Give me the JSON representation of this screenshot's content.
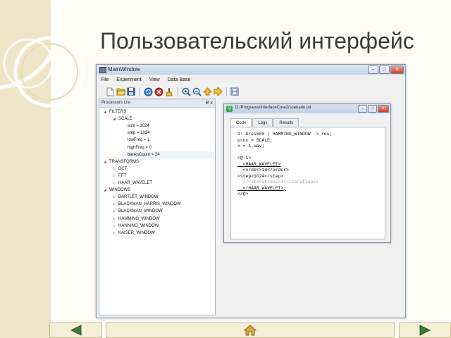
{
  "slide": {
    "title": "Пользовательский интерфейс"
  },
  "window": {
    "title": "MainWindow",
    "buttons": {
      "minimize": "–",
      "maximize": "□",
      "close": "x"
    }
  },
  "menu": [
    {
      "label": "File"
    },
    {
      "label": "Experiment"
    },
    {
      "label": "View"
    },
    {
      "label": "Data Base"
    }
  ],
  "toolbar": {
    "icons": [
      "new-file-icon",
      "open-folder-icon",
      "save-icon",
      "refresh-icon",
      "stop-icon",
      "brush-icon",
      "zoom-in-icon",
      "zoom-out-icon",
      "arrow-up-icon",
      "arrow-forward-icon",
      "export-icon"
    ]
  },
  "panel": {
    "title": "Processors List",
    "controls": "₽ x"
  },
  "tree": [
    {
      "label": "FILTERS",
      "level": 0,
      "expanded": true
    },
    {
      "label": "SCALE",
      "level": 1,
      "expanded": true
    },
    {
      "label": "size = 1024",
      "level": 2
    },
    {
      "label": "step = 1024",
      "level": 2
    },
    {
      "label": "lowFreq = 1",
      "level": 2
    },
    {
      "label": "highFreq = 0",
      "level": 2
    },
    {
      "label": "banksCount = 24",
      "level": 2,
      "selected": true
    },
    {
      "label": "TRANSFORMS",
      "level": 0,
      "expanded": true
    },
    {
      "label": "DCT",
      "level": 1,
      "expanded": false
    },
    {
      "label": "FFT",
      "level": 1,
      "expanded": false
    },
    {
      "label": "HAAR_WAVELET",
      "level": 1,
      "expanded": false
    },
    {
      "label": "WINDOWS",
      "level": 0,
      "expanded": true
    },
    {
      "label": "BARTLET_WINDOW",
      "level": 1,
      "expanded": false
    },
    {
      "label": "BLACKMAN_HARRIS_WINDOW",
      "level": 1,
      "expanded": false
    },
    {
      "label": "BLACKMAN_WINDOW",
      "level": 1,
      "expanded": false
    },
    {
      "label": "HAMMING_WINDOW",
      "level": 1,
      "expanded": false
    },
    {
      "label": "HANNING_WINDOW",
      "level": 1,
      "expanded": false
    },
    {
      "label": "KAISER_WINDOW",
      "level": 1,
      "expanded": false
    }
  ],
  "editor": {
    "title": "D:/Programs/InterfaceCore2/scenario.txt",
    "icon_letter": "Q",
    "tabs": [
      {
        "label": "Code",
        "active": true
      },
      {
        "label": "Logs",
        "active": false
      },
      {
        "label": "Results",
        "active": false
      }
    ],
    "lines": [
      "1: &res500 | HAMMING_WINDOW -> res;",
      "proc = SCALE;",
      "x = 1.wav;",
      "",
      "<@ 1>",
      "  <HAAR_WAVELET>",
      "  <order>10</order>",
      "<step>1024</step>",
      "  //<iterations>1</iterations>",
      "  </HAAR_WAVELET>;",
      "</@>"
    ]
  },
  "nav": {
    "back_icon": "triangle-left-icon",
    "home_icon": "home-icon",
    "forward_icon": "triangle-right-icon"
  }
}
